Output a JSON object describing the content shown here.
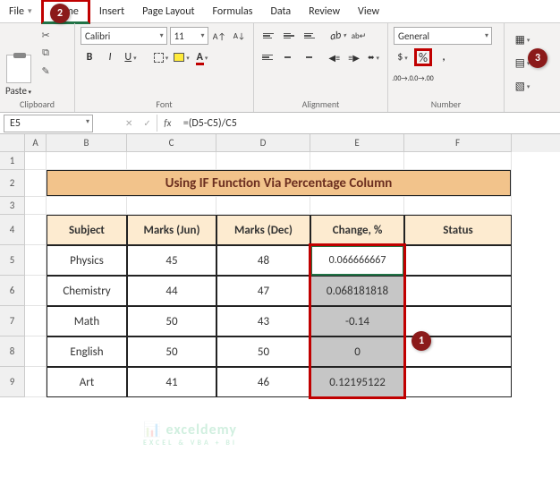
{
  "tabs": {
    "file": "File",
    "home": "Home",
    "insert": "Insert",
    "pagelayout": "Page Layout",
    "formulas": "Formulas",
    "data": "Data",
    "review": "Review",
    "view": "View"
  },
  "ribbon": {
    "paste_label": "Paste",
    "font_name": "Calibri",
    "font_size": "11",
    "bold": "B",
    "italic": "I",
    "underline": "U",
    "number_format": "General",
    "dollar": "$",
    "percent": "%",
    "comma": ",",
    "groups": {
      "clipboard": "Clipboard",
      "font": "Font",
      "alignment": "Alignment",
      "number": "Number"
    },
    "dialog_launch": "⤡"
  },
  "namebox": "E5",
  "formula": "=(D5-C5)/C5",
  "cols": [
    "A",
    "B",
    "C",
    "D",
    "E",
    "F"
  ],
  "rows": [
    "1",
    "2",
    "3",
    "4",
    "5",
    "6",
    "7",
    "8",
    "9"
  ],
  "title": "Using IF Function Via Percentage Column",
  "headers": {
    "b": "Subject",
    "c": "Marks (Jun)",
    "d": "Marks (Dec)",
    "e": "Change, %",
    "f": "Status"
  },
  "data": [
    {
      "b": "Physics",
      "c": "45",
      "d": "48",
      "e": "0.066666667",
      "f": ""
    },
    {
      "b": "Chemistry",
      "c": "44",
      "d": "47",
      "e": "0.068181818",
      "f": ""
    },
    {
      "b": "Math",
      "c": "50",
      "d": "43",
      "e": "-0.14",
      "f": ""
    },
    {
      "b": "English",
      "c": "50",
      "d": "50",
      "e": "0",
      "f": ""
    },
    {
      "b": "Art",
      "c": "41",
      "d": "46",
      "e": "0.12195122",
      "f": ""
    }
  ],
  "callouts": {
    "one": "1",
    "two": "2",
    "three": "3"
  },
  "watermark": {
    "brand": "exceldemy",
    "tag": "EXCEL & VBA + BI"
  }
}
